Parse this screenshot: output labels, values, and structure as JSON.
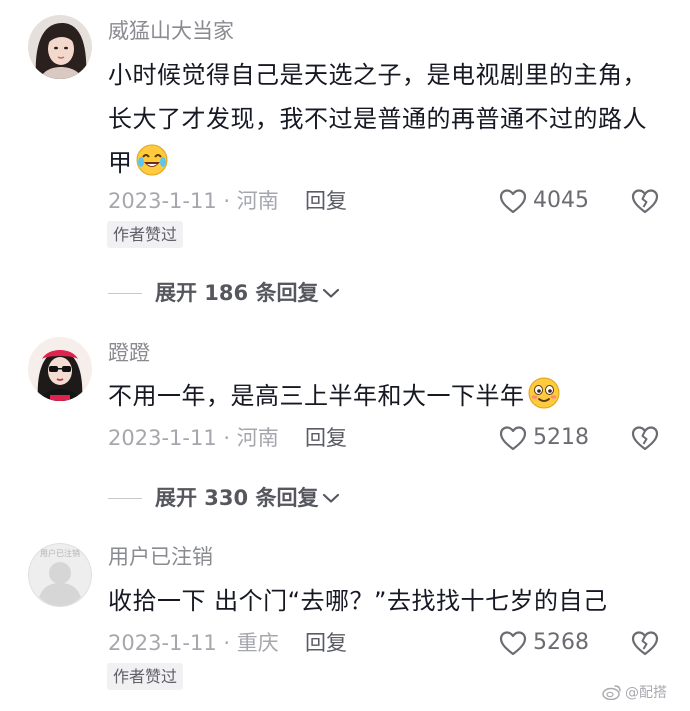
{
  "comments": [
    {
      "username": "威猛山大当家",
      "text": "小时候觉得自己是天选之子，是电视剧里的主角，长大了才发现，我不过是普通的再普通不过的路人甲",
      "emoji_icon": "laugh-cry-emoji",
      "meta": "2023-1-11 · 河南",
      "reply_label": "回复",
      "likes": "4045",
      "badge": "作者赞过",
      "expand_label": "展开 186 条回复"
    },
    {
      "username": "蹬蹬",
      "text": "不用一年，是高三上半年和大一下半年",
      "emoji_icon": "smile-emoji",
      "meta": "2023-1-11 · 河南",
      "reply_label": "回复",
      "likes": "5218",
      "expand_label": "展开 330 条回复"
    },
    {
      "username": "用户已注销",
      "avatar_text": "用户已注销",
      "text": "收拾一下 出个门“去哪？”去找找十七岁的自己",
      "meta": "2023-1-11 · 重庆",
      "reply_label": "回复",
      "likes": "5268",
      "badge": "作者赞过"
    }
  ],
  "watermark": "@配搭",
  "colors": {
    "text": "#161823",
    "username": "#8a8b91",
    "meta": "#a6a7ad",
    "badge_bg": "#f1f1f3"
  }
}
